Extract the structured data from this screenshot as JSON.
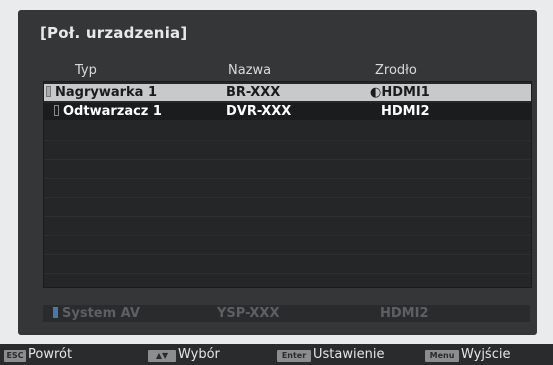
{
  "screen": {
    "title": "[Poł. urzadzenia]"
  },
  "columns": {
    "type": "Typ",
    "name": "Nazwa",
    "source": "Zrodło"
  },
  "devices": [
    {
      "type": "Nagrywarka 1",
      "name": "BR-XXX",
      "source": "HDMI1",
      "active_icon": "power-icon",
      "selected": true
    },
    {
      "type": "Odtwarzacz 1",
      "name": "DVR-XXX",
      "source": "HDMI2",
      "selected": false
    }
  ],
  "av_system": {
    "type": "System AV",
    "name": "YSP-XXX",
    "source": "HDMI2"
  },
  "footer": {
    "back_key": "ESC",
    "back_label": "Powrót",
    "select_key": "▲▼",
    "select_label": "Wybór",
    "enter_key": "Enter",
    "enter_label": "Ustawienie",
    "menu_key": "Menu",
    "menu_label": "Wyjście"
  },
  "colors": {
    "highlight": "#c7c9ca",
    "panel": "#343638",
    "av_marker": "#4a78a8"
  }
}
